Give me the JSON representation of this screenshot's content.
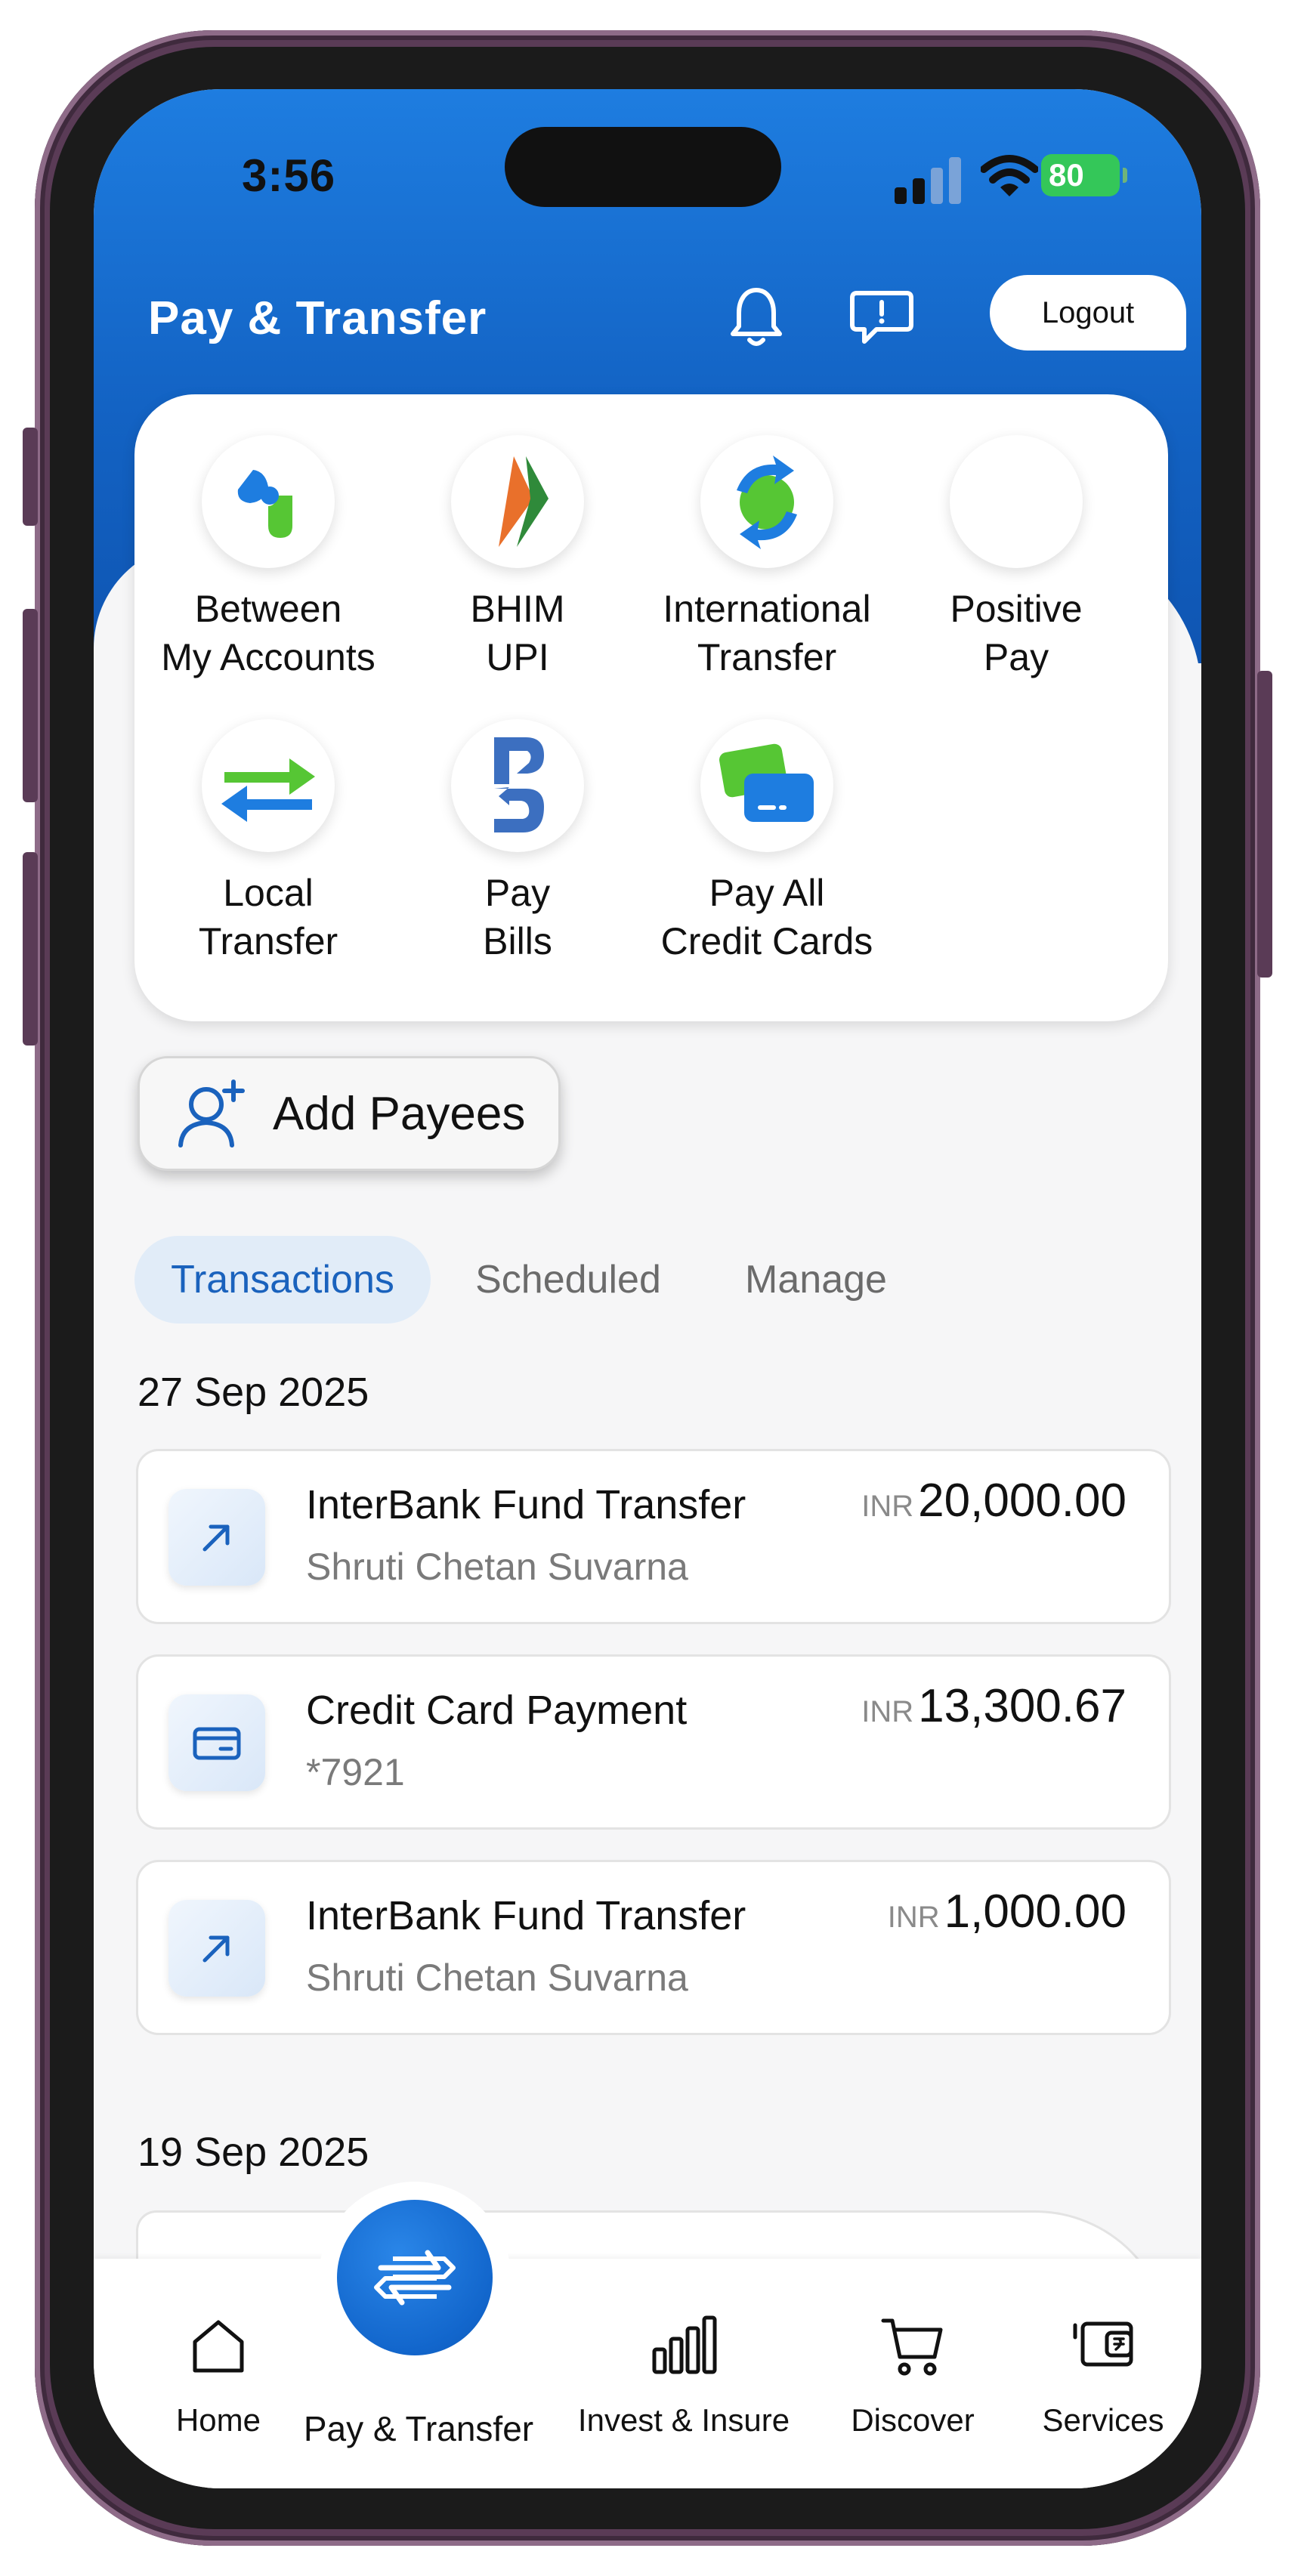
{
  "status_bar": {
    "time": "3:56",
    "battery": "80"
  },
  "header": {
    "title": "Pay & Transfer",
    "logout_label": "Logout"
  },
  "quick_actions": [
    {
      "label": "Between\nMy Accounts",
      "icon": "between-accounts-icon"
    },
    {
      "label": "BHIM\nUPI",
      "icon": "bhim-upi-icon"
    },
    {
      "label": "International\nTransfer",
      "icon": "international-transfer-icon"
    },
    {
      "label": "Positive\nPay",
      "icon": "positive-pay-icon"
    },
    {
      "label": "Local\nTransfer",
      "icon": "local-transfer-icon"
    },
    {
      "label": "Pay\nBills",
      "icon": "pay-bills-icon"
    },
    {
      "label": "Pay All\nCredit Cards",
      "icon": "credit-cards-icon"
    }
  ],
  "add_payees": {
    "label": "Add Payees"
  },
  "tabs": [
    {
      "label": "Transactions",
      "active": true
    },
    {
      "label": "Scheduled",
      "active": false
    },
    {
      "label": "Manage",
      "active": false
    }
  ],
  "transaction_groups": [
    {
      "date": "27 Sep 2025",
      "items": [
        {
          "title": "InterBank Fund Transfer",
          "subtitle": "Shruti Chetan Suvarna",
          "currency": "INR",
          "amount": "20,000.00",
          "icon": "arrow-up-right-icon"
        },
        {
          "title": "Credit Card Payment",
          "subtitle": "*7921",
          "currency": "INR",
          "amount": "13,300.67",
          "icon": "credit-card-icon"
        },
        {
          "title": "InterBank Fund Transfer",
          "subtitle": "Shruti Chetan Suvarna",
          "currency": "INR",
          "amount": "1,000.00",
          "icon": "arrow-up-right-icon"
        }
      ]
    },
    {
      "date": "19 Sep 2025",
      "items": []
    }
  ],
  "bottom_nav": {
    "items": [
      {
        "label": "Home",
        "icon": "home-icon"
      },
      {
        "label": "Pay & Transfer",
        "icon": "transfer-arrows-icon",
        "active": true
      },
      {
        "label": "Invest & Insure",
        "icon": "bar-chart-icon"
      },
      {
        "label": "Discover",
        "icon": "cart-icon"
      },
      {
        "label": "Services",
        "icon": "services-wallet-icon"
      }
    ]
  },
  "colors": {
    "primary": "#1363c4",
    "accent_light": "#e1ecf8",
    "green": "#34c759"
  }
}
